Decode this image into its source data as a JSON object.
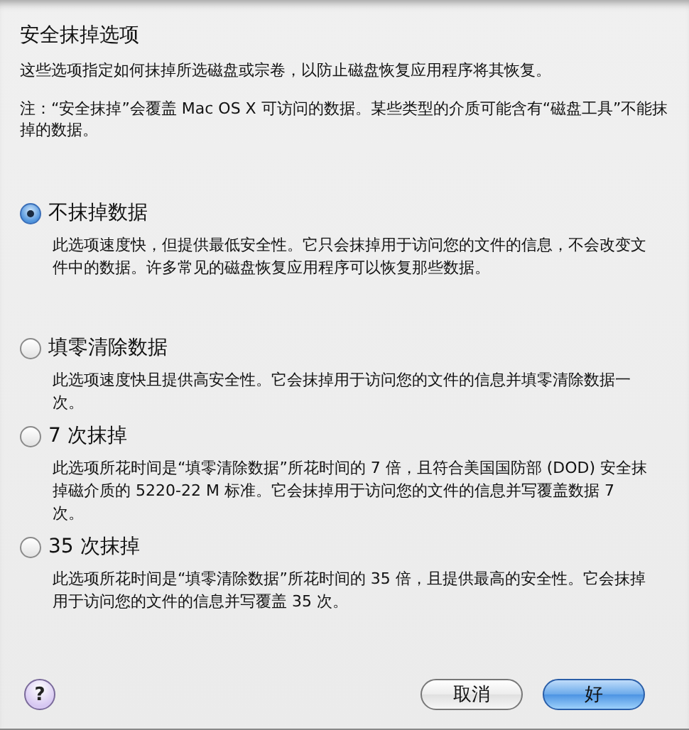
{
  "sheet": {
    "title": "安全抹掉选项",
    "description": "这些选项指定如何抹掉所选磁盘或宗卷，以防止磁盘恢复应用程序将其恢复。",
    "note": "注：“安全抹掉”会覆盖 Mac OS X 可访问的数据。某些类型的介质可能含有“磁盘工具”不能抹掉的数据。"
  },
  "options": [
    {
      "label": "不抹掉数据",
      "selected": true,
      "description": "此选项速度快，但提供最低安全性。它只会抹掉用于访问您的文件的信息，不会改变文件中的数据。许多常见的磁盘恢复应用程序可以恢复那些数据。"
    },
    {
      "label": "填零清除数据",
      "selected": false,
      "description": "此选项速度快且提供高安全性。它会抹掉用于访问您的文件的信息并填零清除数据一次。"
    },
    {
      "label": "7 次抹掉",
      "selected": false,
      "description": "此选项所花时间是“填零清除数据”所花时间的 7 倍，且符合美国国防部 (DOD) 安全抹掉磁介质的 5220-22 M 标准。它会抹掉用于访问您的文件的信息并写覆盖数据 7 次。"
    },
    {
      "label": "35 次抹掉",
      "selected": false,
      "description": "此选项所花时间是“填零清除数据”所花时间的 35 倍，且提供最高的安全性。它会抹掉用于访问您的文件的信息并写覆盖 35 次。"
    }
  ],
  "buttons": {
    "help": "?",
    "cancel": "取消",
    "ok": "好"
  }
}
